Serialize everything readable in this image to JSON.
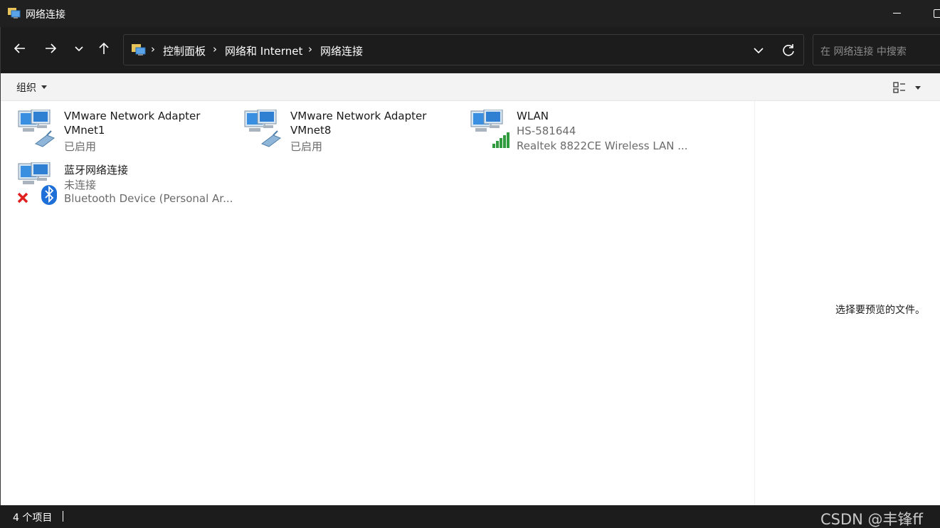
{
  "window": {
    "title": "网络连接"
  },
  "nav": {
    "breadcrumbs": [
      "控制面板",
      "网络和 Internet",
      "网络连接"
    ],
    "search_placeholder": "在 网络连接 中搜索"
  },
  "command_bar": {
    "organize_label": "组织"
  },
  "items": [
    {
      "name": "VMware Network Adapter",
      "line2": "VMnet1",
      "line3": "已启用",
      "icon": "ethernet-adapter-icon"
    },
    {
      "name": "VMware Network Adapter",
      "line2": "VMnet8",
      "line3": "已启用",
      "icon": "ethernet-adapter-icon"
    },
    {
      "name": "WLAN",
      "line2": "HS-581644",
      "line3": "Realtek 8822CE Wireless LAN ...",
      "icon": "wifi-adapter-icon"
    },
    {
      "name": "蓝牙网络连接",
      "line2": "未连接",
      "line3": "Bluetooth Device (Personal Ar...",
      "icon": "bluetooth-adapter-icon"
    }
  ],
  "preview": {
    "text": "选择要预览的文件。"
  },
  "status": {
    "item_count": "4 个项目"
  },
  "watermark": "CSDN @丰锋ff",
  "colors": {
    "dark_chrome": "#1c1c1c",
    "content_bg": "#ffffff",
    "secondary_text": "#6b6b6b"
  }
}
